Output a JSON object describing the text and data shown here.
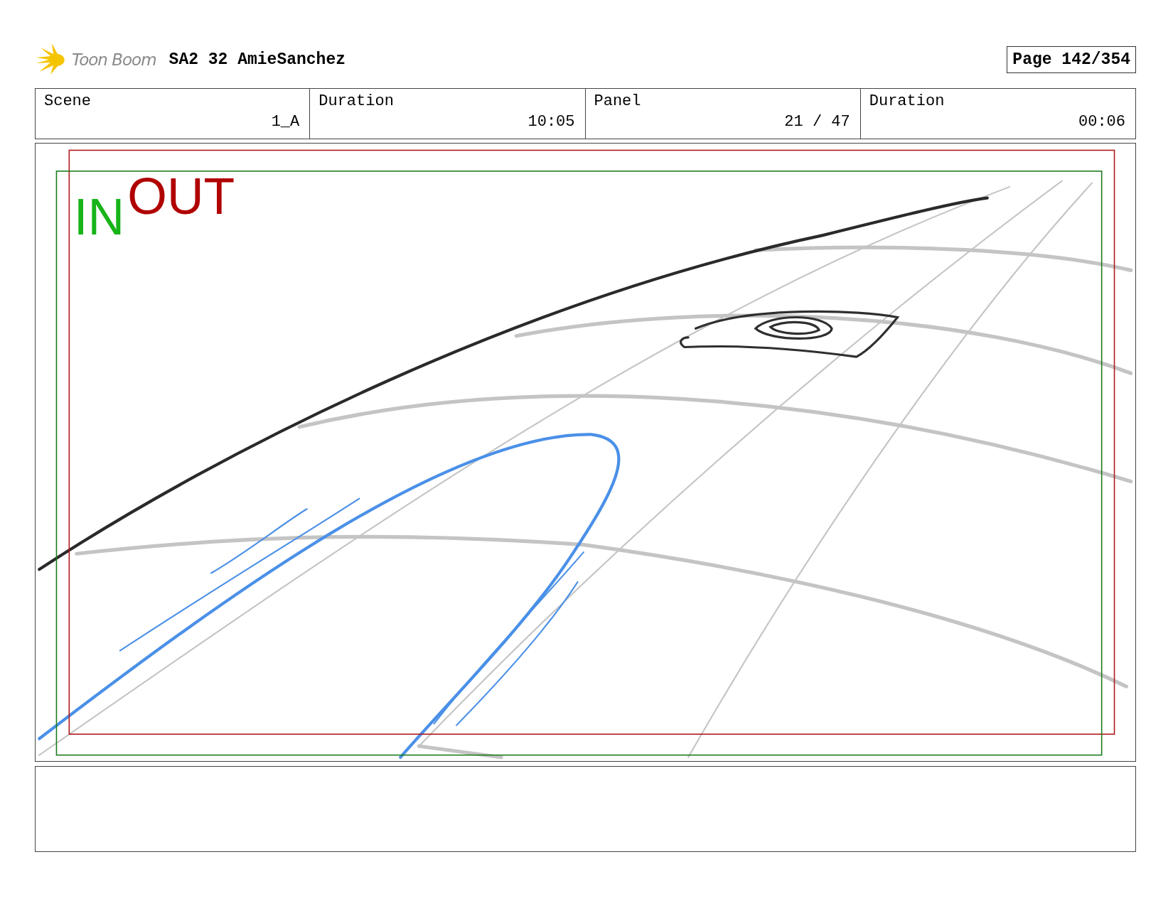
{
  "header": {
    "logo_text": "Toon Boom",
    "project": "SA2 32 AmieSanchez",
    "page": "Page 142/354"
  },
  "fields": [
    {
      "label": "Scene",
      "value": "1_A"
    },
    {
      "label": "Duration",
      "value": "10:05"
    },
    {
      "label": "Panel",
      "value": "21 / 47"
    },
    {
      "label": "Duration",
      "value": "00:06"
    }
  ],
  "panel": {
    "in_label": "IN",
    "out_label": "OUT"
  }
}
